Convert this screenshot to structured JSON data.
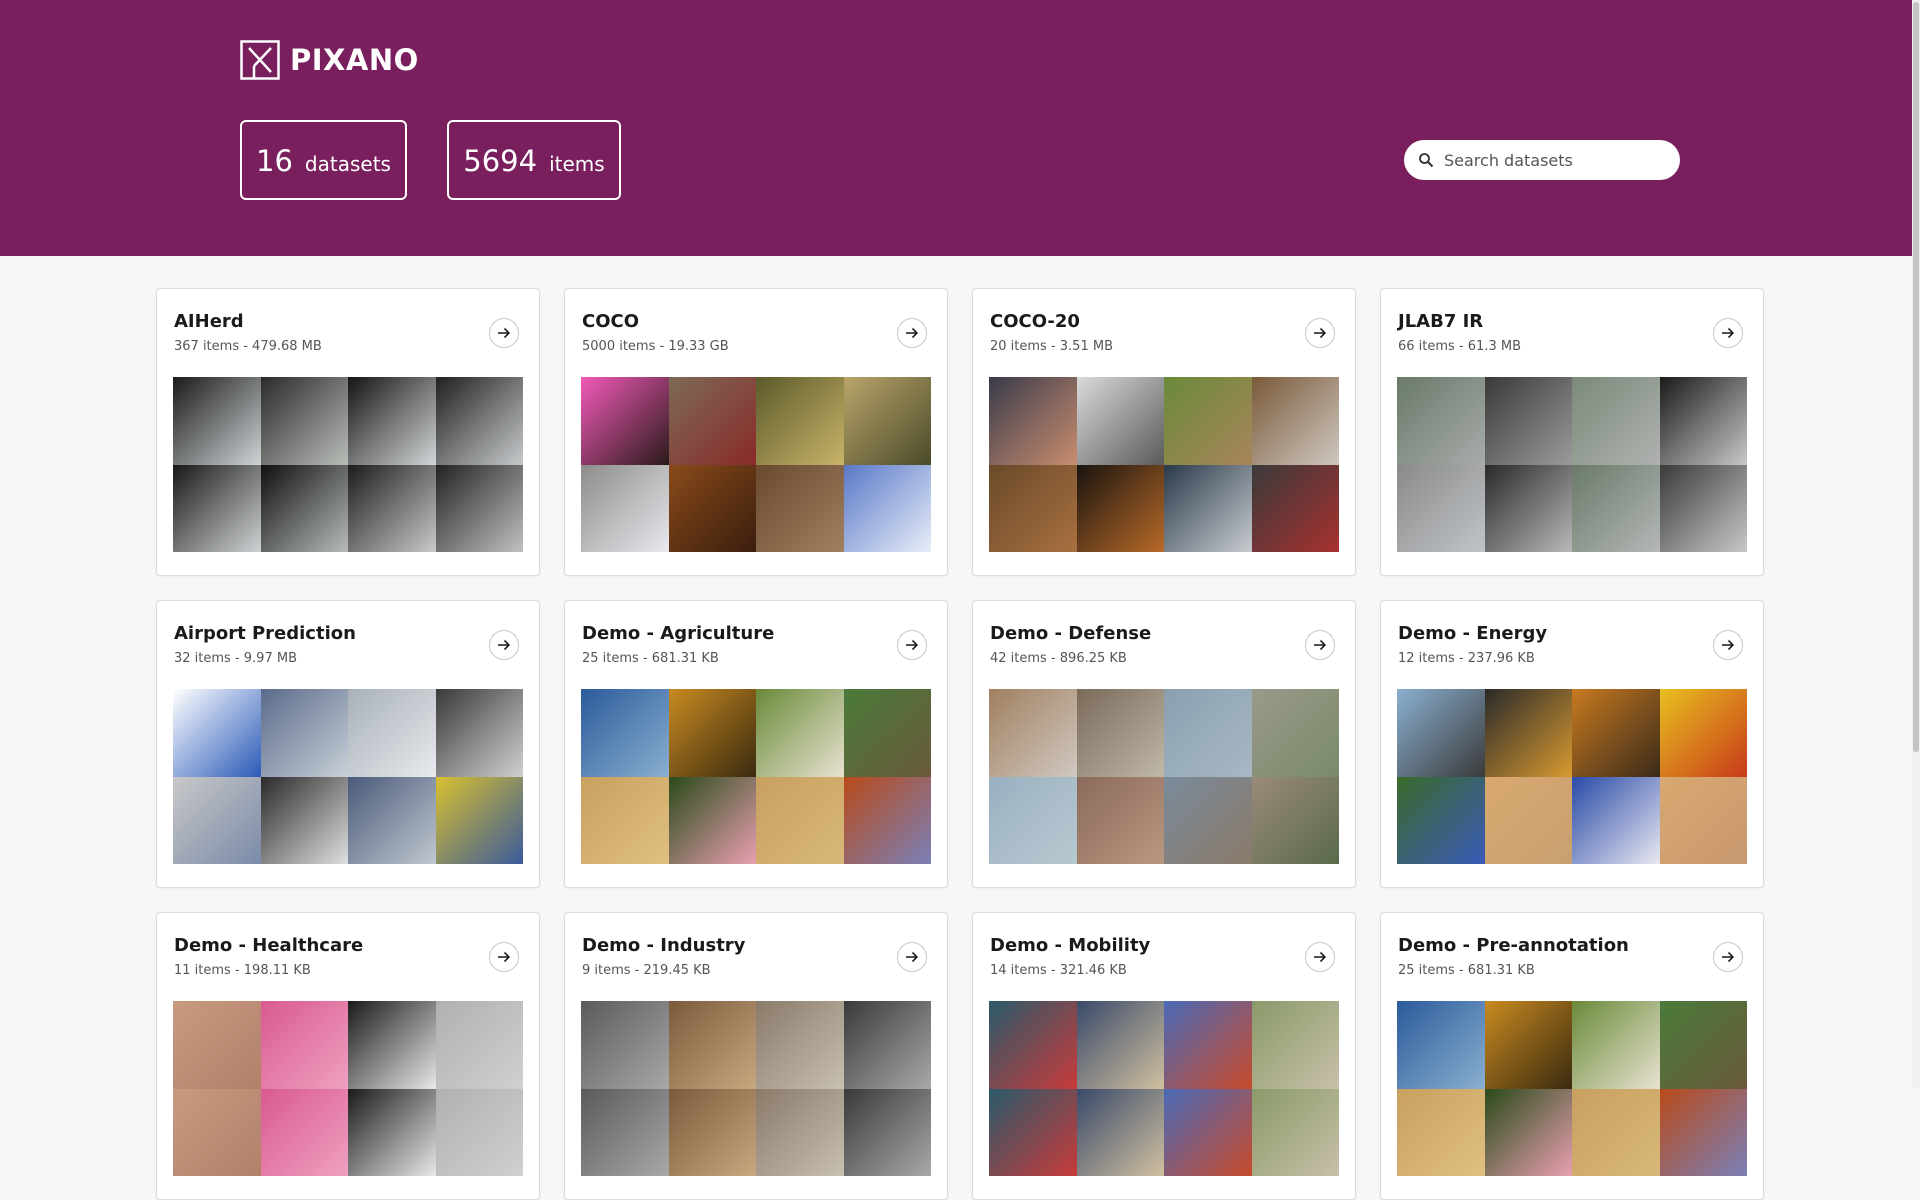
{
  "app": {
    "name": "PIXANO"
  },
  "stats": {
    "datasets_count": "16",
    "datasets_label": "datasets",
    "items_count": "5694",
    "items_label": "items"
  },
  "search": {
    "placeholder": "Search datasets"
  },
  "colors": {
    "header": "#7a1f5e",
    "background": "#f7f7f9"
  },
  "datasets": [
    {
      "name": "AIHerd",
      "meta": "367 items - 479.68 MB",
      "thumbs": [
        [
          "#1a1a1a",
          "#cfd4d6"
        ],
        [
          "#2a2a2a",
          "#b9bdb8"
        ],
        [
          "#141414",
          "#d3d6d8"
        ],
        [
          "#202020",
          "#c7cacc"
        ],
        [
          "#181818",
          "#d0d3d5"
        ],
        [
          "#0f0f0f",
          "#b8bcbc"
        ],
        [
          "#1c1c1c",
          "#c9cbc8"
        ],
        [
          "#222222",
          "#bfc2c0"
        ]
      ]
    },
    {
      "name": "COCO",
      "meta": "5000 items - 19.33 GB",
      "thumbs": [
        [
          "#f25ab8",
          "#2a1a1a"
        ],
        [
          "#7d6a55",
          "#8a2a2a"
        ],
        [
          "#5b5a2a",
          "#c9b46a"
        ],
        [
          "#b9a56a",
          "#4a4a2a"
        ],
        [
          "#8c8c8c",
          "#e9e9ee"
        ],
        [
          "#8a4a1a",
          "#3a1e0e"
        ],
        [
          "#6a4a2e",
          "#a08060"
        ],
        [
          "#5a78c8",
          "#e8eef8"
        ]
      ]
    },
    {
      "name": "COCO-20",
      "meta": "20 items - 3.51 MB",
      "thumbs": [
        [
          "#3a3a4a",
          "#c98e70"
        ],
        [
          "#d8dadc",
          "#5a5a5a"
        ],
        [
          "#6a8a3a",
          "#a8855a"
        ],
        [
          "#7a5a3a",
          "#cfc8c0"
        ],
        [
          "#6a4a2a",
          "#a87040"
        ],
        [
          "#1a1410",
          "#b86a28"
        ],
        [
          "#2a3a4a",
          "#c8ccd0"
        ],
        [
          "#3a3a3a",
          "#a83030"
        ]
      ]
    },
    {
      "name": "JLAB7 IR",
      "meta": "66 items - 61.3 MB",
      "thumbs": [
        [
          "#6a7a6a",
          "#a8acaa"
        ],
        [
          "#3a3a3a",
          "#9a9a9a"
        ],
        [
          "#7a8a7a",
          "#b0b2b0"
        ],
        [
          "#1a1a1a",
          "#c8c8c8"
        ],
        [
          "#8a8a8a",
          "#c0c4c8"
        ],
        [
          "#2a2a2a",
          "#b8b8b8"
        ],
        [
          "#6a7a6a",
          "#b4b8b6"
        ],
        [
          "#3a3a3a",
          "#c8c8c8"
        ]
      ]
    },
    {
      "name": "Airport Prediction",
      "meta": "32 items - 9.97 MB",
      "thumbs": [
        [
          "#ffffff",
          "#2a5ab8"
        ],
        [
          "#5a6a8a",
          "#c8d0d8"
        ],
        [
          "#a8b0b8",
          "#e8eaee"
        ],
        [
          "#3a3a3a",
          "#d0d0d0"
        ],
        [
          "#c8c8c8",
          "#7a8aa8"
        ],
        [
          "#2a2a2a",
          "#e0e0e0"
        ],
        [
          "#4a5a7a",
          "#c0c8d0"
        ],
        [
          "#d8c030",
          "#3a5a9a"
        ]
      ]
    },
    {
      "name": "Demo - Agriculture",
      "meta": "25 items - 681.31 KB",
      "thumbs": [
        [
          "#2a5a9a",
          "#8ab0d0"
        ],
        [
          "#c88a20",
          "#3a2a10"
        ],
        [
          "#6a8a3a",
          "#e8e2d0"
        ],
        [
          "#4a7a3a",
          "#6a5a3a"
        ],
        [
          "#c8a060",
          "#e0c080"
        ],
        [
          "#2a4a1a",
          "#e8a0b0"
        ],
        [
          "#c8a060",
          "#d8b878"
        ],
        [
          "#b84a1a",
          "#7a80b8"
        ]
      ]
    },
    {
      "name": "Demo - Defense",
      "meta": "42 items - 896.25 KB",
      "thumbs": [
        [
          "#a08060",
          "#d0c8c0"
        ],
        [
          "#7a6a5a",
          "#c0b8a8"
        ],
        [
          "#8aa0b0",
          "#a8b8c4"
        ],
        [
          "#9a9a8a",
          "#7a8a6a"
        ],
        [
          "#9ab0c0",
          "#b8c8d0"
        ],
        [
          "#8a6a5a",
          "#b89880"
        ],
        [
          "#7a8a9a",
          "#8a7a6a"
        ],
        [
          "#9a8a7a",
          "#5a6a4a"
        ]
      ]
    },
    {
      "name": "Demo - Energy",
      "meta": "12 items - 237.96 KB",
      "thumbs": [
        [
          "#8ab0d0",
          "#3a3a3a"
        ],
        [
          "#2a2a2a",
          "#d89a30"
        ],
        [
          "#c87a20",
          "#3a2a1a"
        ],
        [
          "#e8c020",
          "#c83a1a"
        ],
        [
          "#3a6a2a",
          "#3a5ab8"
        ],
        [
          "#d8a870",
          "#c8a070"
        ],
        [
          "#2a4aa8",
          "#e8e8f0"
        ],
        [
          "#d8a870",
          "#c89870"
        ]
      ]
    },
    {
      "name": "Demo - Healthcare",
      "meta": "11 items - 198.11 KB",
      "thumbs": [
        [
          "#c89a80",
          "#b08068"
        ],
        [
          "#d85a90",
          "#f0a0c0"
        ],
        [
          "#1a1a1a",
          "#e8e8e8"
        ],
        [
          "#b0b0b0",
          "#d0d0d0"
        ],
        [
          "#c89a80",
          "#b08068"
        ],
        [
          "#d85a90",
          "#f0a0c0"
        ],
        [
          "#1a1a1a",
          "#e8e8e8"
        ],
        [
          "#b0b0b0",
          "#d0d0d0"
        ]
      ]
    },
    {
      "name": "Demo - Industry",
      "meta": "9 items - 219.45 KB",
      "thumbs": [
        [
          "#5a5a5a",
          "#a8a8a8"
        ],
        [
          "#7a5a3a",
          "#c8a880"
        ],
        [
          "#8a7a6a",
          "#c8c0b0"
        ],
        [
          "#3a3a3a",
          "#a8a8a8"
        ],
        [
          "#5a5a5a",
          "#a8a8a8"
        ],
        [
          "#7a5a3a",
          "#c8a880"
        ],
        [
          "#8a7a6a",
          "#c8c0b0"
        ],
        [
          "#3a3a3a",
          "#a8a8a8"
        ]
      ]
    },
    {
      "name": "Demo - Mobility",
      "meta": "14 items - 321.46 KB",
      "thumbs": [
        [
          "#2a5a6a",
          "#c83a3a"
        ],
        [
          "#3a4a6a",
          "#d0c0a0"
        ],
        [
          "#4a6ab8",
          "#c84a2a"
        ],
        [
          "#8a9a6a",
          "#c8c0a8"
        ],
        [
          "#2a5a6a",
          "#c83a3a"
        ],
        [
          "#3a4a6a",
          "#d0c0a0"
        ],
        [
          "#4a6ab8",
          "#c84a2a"
        ],
        [
          "#8a9a6a",
          "#c8c0a8"
        ]
      ]
    },
    {
      "name": "Demo - Pre-annotation",
      "meta": "25 items - 681.31 KB",
      "thumbs": [
        [
          "#2a5a9a",
          "#8ab0d0"
        ],
        [
          "#c88a20",
          "#3a2a10"
        ],
        [
          "#6a8a3a",
          "#e8e2d0"
        ],
        [
          "#4a7a3a",
          "#6a5a3a"
        ],
        [
          "#c8a060",
          "#e0c080"
        ],
        [
          "#2a4a1a",
          "#e8a0b0"
        ],
        [
          "#c8a060",
          "#d8b878"
        ],
        [
          "#b84a1a",
          "#7a80b8"
        ]
      ]
    }
  ]
}
